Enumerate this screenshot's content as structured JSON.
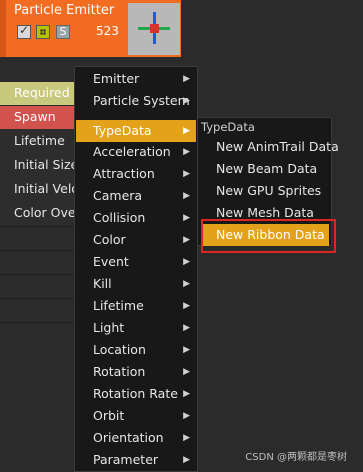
{
  "emitter": {
    "title": "Particle Emitter",
    "count": "523",
    "solo_label": "S",
    "colors": {
      "header": "#f26c22",
      "required": "#c9c97e",
      "spawn": "#d2524d"
    }
  },
  "modules": [
    {
      "label": "Required"
    },
    {
      "label": "Spawn"
    },
    {
      "label": "Lifetime"
    },
    {
      "label": "Initial Size"
    },
    {
      "label": "Initial Velo"
    },
    {
      "label": "Color Over"
    }
  ],
  "menu": {
    "items": [
      {
        "label": "Emitter",
        "icon": "chevron-right-icon"
      },
      {
        "label": "Particle System",
        "icon": "chevron-right-icon"
      },
      {
        "label": "TypeData",
        "icon": "chevron-right-icon",
        "active": true
      },
      {
        "label": "Acceleration",
        "icon": "chevron-right-icon"
      },
      {
        "label": "Attraction",
        "icon": "chevron-right-icon"
      },
      {
        "label": "Camera",
        "icon": "chevron-right-icon"
      },
      {
        "label": "Collision",
        "icon": "chevron-right-icon"
      },
      {
        "label": "Color",
        "icon": "chevron-right-icon"
      },
      {
        "label": "Event",
        "icon": "chevron-right-icon"
      },
      {
        "label": "Kill",
        "icon": "chevron-right-icon"
      },
      {
        "label": "Lifetime",
        "icon": "chevron-right-icon"
      },
      {
        "label": "Light",
        "icon": "chevron-right-icon"
      },
      {
        "label": "Location",
        "icon": "chevron-right-icon"
      },
      {
        "label": "Rotation",
        "icon": "chevron-right-icon"
      },
      {
        "label": "Rotation Rate",
        "icon": "chevron-right-icon"
      },
      {
        "label": "Orbit",
        "icon": "chevron-right-icon"
      },
      {
        "label": "Orientation",
        "icon": "chevron-right-icon"
      },
      {
        "label": "Parameter",
        "icon": "chevron-right-icon"
      }
    ],
    "accent": "#e3a21a"
  },
  "submenu": {
    "header": "TypeData",
    "items": [
      {
        "label": "New AnimTrail Data"
      },
      {
        "label": "New Beam Data"
      },
      {
        "label": "New GPU Sprites"
      },
      {
        "label": "New Mesh Data"
      },
      {
        "label": "New Ribbon Data",
        "active": true
      }
    ],
    "highlight_color": "#e02424"
  },
  "watermark": "CSDN @两颗都是枣树"
}
